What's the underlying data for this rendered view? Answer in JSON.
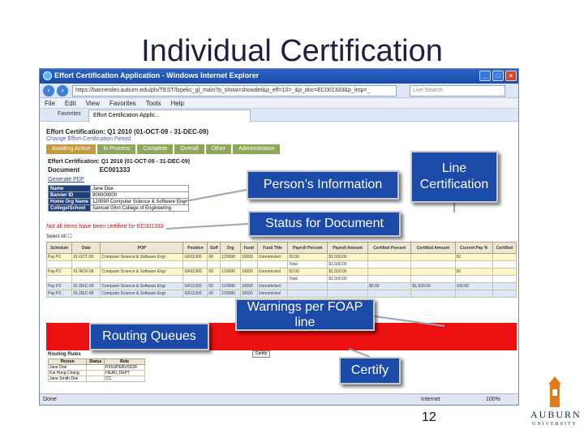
{
  "slide": {
    "title": "Individual Certification",
    "page_number": "12"
  },
  "browser": {
    "window_title": "Effort Certification Application - Windows Internet Explorer",
    "url": "https://bannerdev.auburn.edu/pls/TEST/fzpekc_gl_main?p_show=showdet&p_eff=10=_&p_doc=EC001333&p_tmp=_",
    "search_placeholder": "Live Search",
    "menu": [
      "File",
      "Edit",
      "View",
      "Favorites",
      "Tools",
      "Help"
    ],
    "favorites_label": "Favorites",
    "tab_label": "Effort Certification Applic...",
    "status_done": "Done",
    "status_zone": "Internet",
    "status_zoom": "100%"
  },
  "app": {
    "header": "Effort Certification: Q1 2010 (01-OCT-09 - 31-DEC-09)",
    "change_period": "Change Effort Certification Period",
    "nav_tabs": [
      "Awaiting Action",
      "In Process",
      "Complete",
      "Overall",
      "Other",
      "Administration"
    ],
    "cert_line": "Effort Certification: Q1 2010 (01-OCT-09 - 31-DEC-09)",
    "document_label": "Document",
    "document_value": "EC001333",
    "generate_pdf": "Generate PDF",
    "person": [
      {
        "k": "Name",
        "v": "Jane Doe"
      },
      {
        "k": "Banner ID",
        "v": "900000000"
      },
      {
        "k": "Home Org Name",
        "v": "120090 Computer Science & Software Engr"
      },
      {
        "k": "College/School",
        "v": "Samuel Ginn College of Engineering"
      }
    ],
    "warning": "Not all items have been certified for EC001333",
    "select_all": "Select All",
    "routing_title": "Routing Rules",
    "routing_headers": [
      "Person",
      "Status",
      "Role"
    ],
    "routing_rows": [
      [
        "Jane Doe",
        "",
        "PI/SUPERVISOR"
      ],
      [
        "Kai Hung Chang",
        "",
        "HEAD_DEPT"
      ],
      [
        "Jane Smith Doe",
        "",
        "CC"
      ]
    ],
    "certify_button": "Certify"
  },
  "grid": {
    "headers": [
      "Schedule",
      "Date",
      "POP",
      "Position",
      "Suff",
      "Org",
      "Fund",
      "Fund Title",
      "Payroll Percent",
      "Payroll Amount",
      "Certified Percent",
      "Certified Amount",
      "Current Pay %",
      "Certified"
    ],
    "rows": [
      {
        "style": "y",
        "cells": [
          "Pay P1",
          "01-OCT-09",
          "Computer Science & Software Engr",
          "GR11300",
          "00",
          "120090",
          "10000",
          "Unrestricted",
          "50.00",
          "$1,500.00",
          "",
          "",
          "50",
          ""
        ]
      },
      {
        "style": "w",
        "cells": [
          "",
          "",
          "",
          "",
          "",
          "",
          "",
          "",
          "Total",
          "$1,500.00",
          "",
          "",
          "",
          ""
        ]
      },
      {
        "style": "y",
        "cells": [
          "Pay P2",
          "01-NOV-09",
          "Computer Science & Software Engr",
          "GR11300",
          "00",
          "120090",
          "10000",
          "Unrestricted",
          "50.00",
          "$1,500.00",
          "",
          "",
          "50",
          ""
        ]
      },
      {
        "style": "w",
        "cells": [
          "",
          "",
          "",
          "",
          "",
          "",
          "",
          "",
          "Total",
          "$1,500.00",
          "",
          "",
          "",
          ""
        ]
      },
      {
        "style": "b",
        "cells": [
          "Pay P3",
          "01-DEC-09",
          "Computer Science & Software Engr",
          "GR11300",
          "00",
          "120090",
          "10000",
          "Unrestricted",
          "",
          "",
          "$0.00",
          "$1,500.00",
          "100.00",
          ""
        ]
      },
      {
        "style": "b",
        "cells": [
          "Pay P3",
          "01-DEC-09",
          "Computer Science & Software Engr",
          "GR11300",
          "00",
          "120090",
          "10000",
          "Unrestricted",
          "",
          "",
          "",
          "",
          "",
          ""
        ]
      }
    ]
  },
  "callouts": {
    "person": "Person’s Information",
    "line_cert_1": "Line",
    "line_cert_2": "Certification",
    "status": "Status for Document",
    "warnings_1": "Warnings per FOAP",
    "warnings_2": "line",
    "routing": "Routing Queues",
    "certify": "Certify"
  },
  "logo": {
    "word1": "AUBURN",
    "word2": "UNIVERSITY"
  },
  "colors": {
    "callout_bg": "#1b4aa8",
    "warning_red": "#ee1111",
    "title_color": "#1f1f3f"
  }
}
